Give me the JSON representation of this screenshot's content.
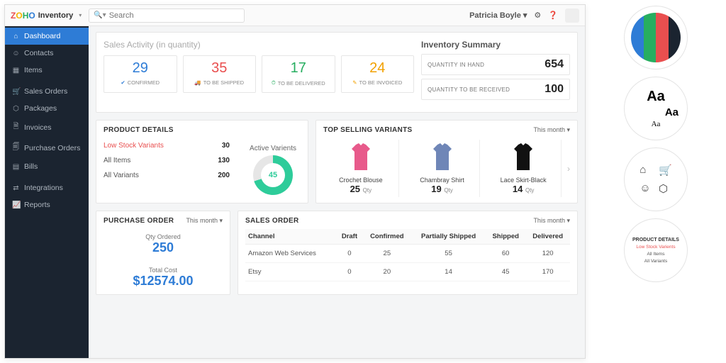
{
  "header": {
    "brand": "Inventory",
    "search_placeholder": "Search",
    "user": "Patricia Boyle"
  },
  "sidebar": [
    {
      "icon": "⌂",
      "label": "Dashboard",
      "active": true
    },
    {
      "icon": "☺",
      "label": "Contacts"
    },
    {
      "icon": "▦",
      "label": "Items"
    },
    {
      "sep": true
    },
    {
      "icon": "🛒",
      "label": "Sales Orders"
    },
    {
      "icon": "⬡",
      "label": "Packages"
    },
    {
      "icon": "🗎",
      "label": "Invoices"
    },
    {
      "icon": "🗐",
      "label": "Purchase Orders"
    },
    {
      "icon": "▤",
      "label": "Bills"
    },
    {
      "sep": true
    },
    {
      "icon": "⇄",
      "label": "Integrations"
    },
    {
      "icon": "📈",
      "label": "Reports"
    }
  ],
  "sales_activity": {
    "title": "Sales Activity",
    "subtitle": "(in quantity)",
    "cards": [
      {
        "num": "29",
        "label": "CONFIRMED",
        "color": "#2e7cd6",
        "icon": "✔"
      },
      {
        "num": "35",
        "label": "TO BE SHIPPED",
        "color": "#e94f4f",
        "icon": "🚚"
      },
      {
        "num": "17",
        "label": "TO BE DELIVERED",
        "color": "#27ae60",
        "icon": "⏱"
      },
      {
        "num": "24",
        "label": "TO BE INVOICED",
        "color": "#f2a100",
        "icon": "✎"
      }
    ]
  },
  "inventory_summary": {
    "title": "Inventory Summary",
    "lines": [
      {
        "k": "QUANTITY IN HAND",
        "v": "654"
      },
      {
        "k": "QUANTITY TO BE RECEIVED",
        "v": "100"
      }
    ]
  },
  "product_details": {
    "title": "PRODUCT DETAILS",
    "rows": [
      {
        "k": "Low Stock Variants",
        "v": "30",
        "low": true
      },
      {
        "k": "All Items",
        "v": "130"
      },
      {
        "k": "All Variants",
        "v": "200"
      }
    ],
    "donut": {
      "title": "Active Varients",
      "value": "45"
    }
  },
  "top_selling": {
    "title": "TOP SELLING VARIANTS",
    "period": "This month",
    "items": [
      {
        "name": "Crochet Blouse",
        "qty": "25",
        "color": "#e85a8b"
      },
      {
        "name": "Chambray Shirt",
        "qty": "19",
        "color": "#6f86b7"
      },
      {
        "name": "Lace Skirt-Black",
        "qty": "14",
        "color": "#111"
      }
    ],
    "qty_suffix": "Qty"
  },
  "purchase_order": {
    "title": "PURCHASE ORDER",
    "period": "This month",
    "qty_label": "Qty Ordered",
    "qty": "250",
    "cost_label": "Total Cost",
    "cost": "$12574.00"
  },
  "sales_order": {
    "title": "SALES ORDER",
    "period": "This month",
    "columns": [
      "Channel",
      "Draft",
      "Confirmed",
      "Partially Shipped",
      "Shipped",
      "Delivered"
    ],
    "rows": [
      {
        "channel": "Amazon Web Services",
        "cells": [
          "0",
          "25",
          "55",
          "60",
          "120"
        ]
      },
      {
        "channel": "Etsy",
        "cells": [
          "0",
          "20",
          "14",
          "45",
          "170"
        ]
      }
    ]
  },
  "style_guide": {
    "palette": [
      "#2e7cd6",
      "#27ae60",
      "#e94f4f",
      "#1b2430"
    ],
    "mini_card": {
      "title": "PRODUCT DETAILS",
      "rows": [
        "Low Stock Varients",
        "All Items",
        "All Variants"
      ]
    }
  }
}
